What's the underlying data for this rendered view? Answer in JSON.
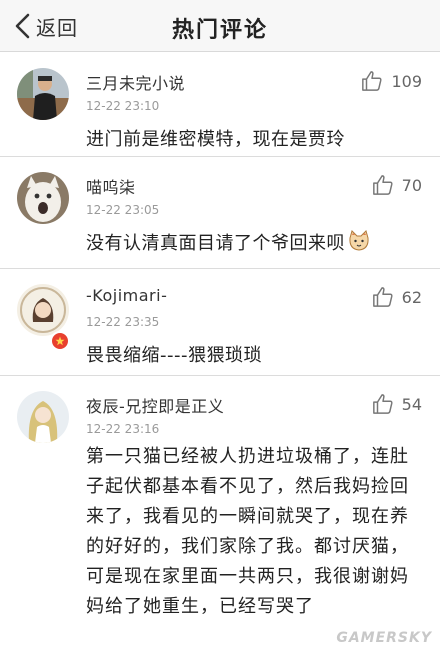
{
  "nav": {
    "back_label": "返回",
    "title": "热门评论"
  },
  "comments": [
    {
      "username": "三月未完小说",
      "time": "12-22 23:10",
      "likes": "109",
      "text": "进门前是维密模特，现在是贾玲"
    },
    {
      "username": "喵呜柒",
      "time": "12-22 23:05",
      "likes": "70",
      "text": "没有认清真面目请了个爷回来呗"
    },
    {
      "username": "-Kojimari-",
      "time": "12-22 23:35",
      "likes": "62",
      "text": "畏畏缩缩----猥猥琐琐"
    },
    {
      "username": "夜辰-兄控即是正义",
      "time": "12-22 23:16",
      "likes": "54",
      "text": "第一只猫已经被人扔进垃圾桶了，连肚子起伏都基本看不见了，然后我妈捡回来了，我看见的一瞬间就哭了，现在养的好好的，我们家除了我。都讨厌猫，可是现在家里面一共两只，我很谢谢妈妈给了她重生，已经写哭了"
    }
  ],
  "watermark": "GAMERSKY",
  "icons": {
    "back": "chevron-left-icon",
    "like": "thumbs-up-icon",
    "badge": "star-badge-icon",
    "emoji": "cat-emoji-icon"
  },
  "colors": {
    "navbar_bg": "#f7f7f7",
    "text": "#222222",
    "meta": "#9a9a9a",
    "badge": "#e8402e"
  }
}
